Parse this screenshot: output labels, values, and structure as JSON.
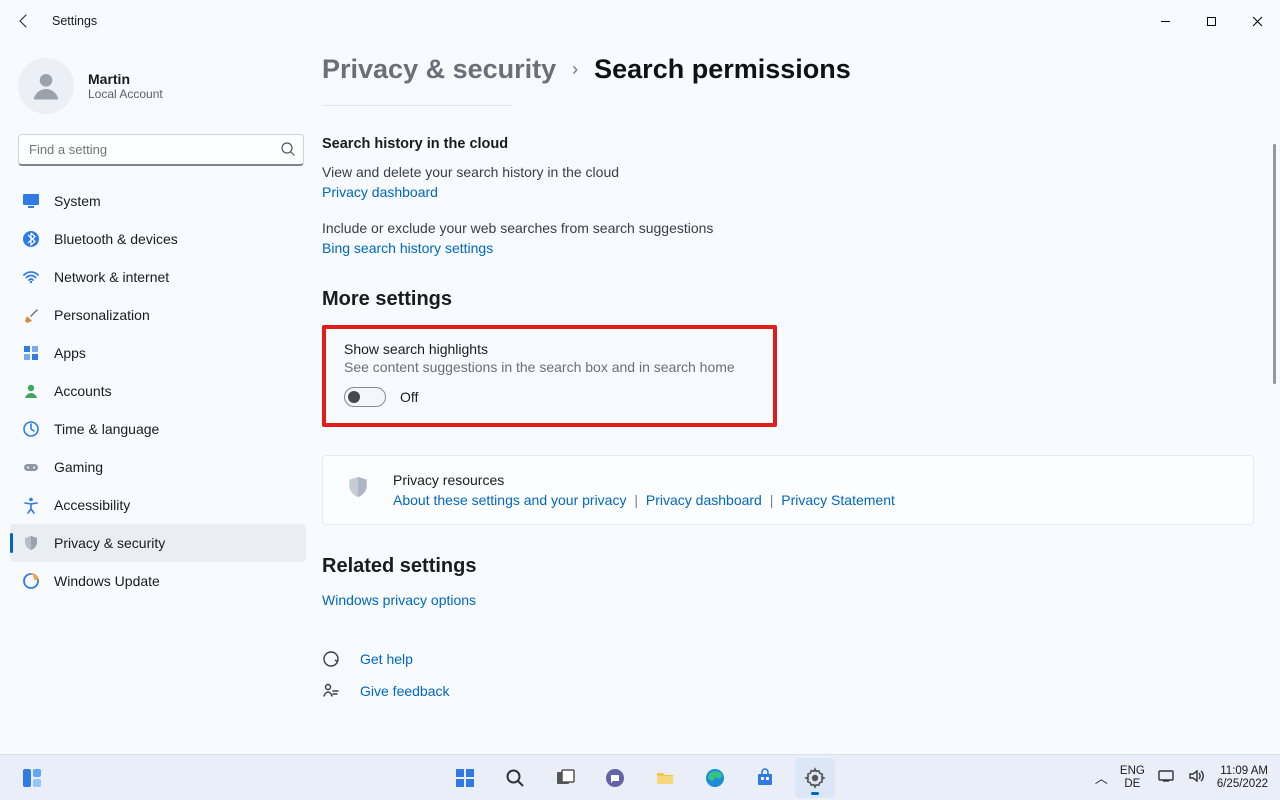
{
  "window": {
    "title": "Settings"
  },
  "user": {
    "name": "Martin",
    "subtext": "Local Account"
  },
  "search": {
    "placeholder": "Find a setting"
  },
  "nav": {
    "items": [
      {
        "label": "System",
        "icon": "monitor-icon"
      },
      {
        "label": "Bluetooth & devices",
        "icon": "bluetooth-icon"
      },
      {
        "label": "Network & internet",
        "icon": "wifi-icon"
      },
      {
        "label": "Personalization",
        "icon": "brush-icon"
      },
      {
        "label": "Apps",
        "icon": "apps-icon"
      },
      {
        "label": "Accounts",
        "icon": "person-icon"
      },
      {
        "label": "Time & language",
        "icon": "clock-globe-icon"
      },
      {
        "label": "Gaming",
        "icon": "gamepad-icon"
      },
      {
        "label": "Accessibility",
        "icon": "accessibility-icon"
      },
      {
        "label": "Privacy & security",
        "icon": "shield-icon"
      },
      {
        "label": "Windows Update",
        "icon": "update-icon"
      }
    ],
    "active_index": 9
  },
  "breadcrumb": {
    "parent": "Privacy & security",
    "page": "Search permissions"
  },
  "cloud_history": {
    "heading": "Search history in the cloud",
    "desc": "View and delete your search history in the cloud",
    "link1": "Privacy dashboard",
    "desc2": "Include or exclude your web searches from search suggestions",
    "link2": "Bing search history settings"
  },
  "more_settings": {
    "heading": "More settings",
    "highlights": {
      "title": "Show search highlights",
      "desc": "See content suggestions in the search box and in search home",
      "toggle_state": "Off"
    }
  },
  "privacy_card": {
    "title": "Privacy resources",
    "link1": "About these settings and your privacy",
    "link2": "Privacy dashboard",
    "link3": "Privacy Statement"
  },
  "related": {
    "heading": "Related settings",
    "link": "Windows privacy options"
  },
  "help": {
    "get_help": "Get help",
    "give_feedback": "Give feedback"
  },
  "taskbar": {
    "lang1": "ENG",
    "lang2": "DE",
    "time": "11:09 AM",
    "date": "6/25/2022"
  }
}
